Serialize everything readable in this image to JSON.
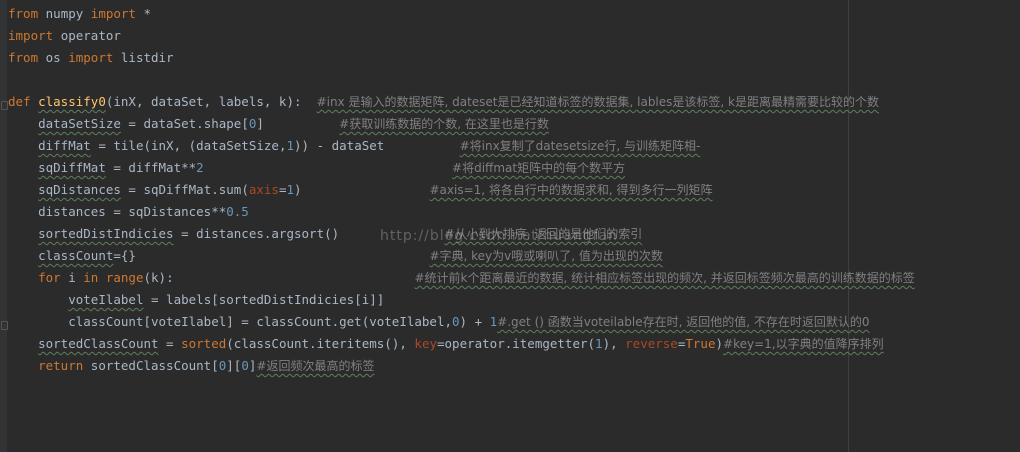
{
  "lines": [
    {
      "segments": [
        {
          "t": "from ",
          "c": "kw"
        },
        {
          "t": "numpy ",
          "c": "op"
        },
        {
          "t": "import ",
          "c": "kw"
        },
        {
          "t": "*",
          "c": "op"
        }
      ]
    },
    {
      "segments": [
        {
          "t": "import ",
          "c": "kw"
        },
        {
          "t": "operator",
          "c": "op"
        }
      ]
    },
    {
      "segments": [
        {
          "t": "from ",
          "c": "kw"
        },
        {
          "t": "os ",
          "c": "op"
        },
        {
          "t": "import ",
          "c": "kw"
        },
        {
          "t": "listdir",
          "c": "op"
        }
      ]
    },
    {
      "segments": []
    },
    {
      "segments": [
        {
          "t": "def ",
          "c": "kw"
        },
        {
          "t": "classify0",
          "c": "fn wavy"
        },
        {
          "t": "(inX, dataSet, labels, k):  ",
          "c": "op"
        },
        {
          "t": "#inx 是输入的数据矩阵, dateset是已经知道标签的数据集, lables是该标签, k是距离最精需要比较的个数",
          "c": "cm wavy"
        }
      ]
    },
    {
      "segments": [
        {
          "t": "    ",
          "c": "op"
        },
        {
          "t": "dataSetSize",
          "c": "op wavy"
        },
        {
          "t": " = dataSet.shape[",
          "c": "op"
        },
        {
          "t": "0",
          "c": "num"
        },
        {
          "t": "]          ",
          "c": "op"
        },
        {
          "t": "#获取训练数据的个数, 在这里也是行数",
          "c": "cm wavy"
        }
      ]
    },
    {
      "segments": [
        {
          "t": "    ",
          "c": "op"
        },
        {
          "t": "diffMat",
          "c": "op wavy"
        },
        {
          "t": " = tile(inX, (dataSetSize,",
          "c": "op"
        },
        {
          "t": "1",
          "c": "num"
        },
        {
          "t": ")) - dataSet          ",
          "c": "op"
        },
        {
          "t": "#将inx复制了datesetsize行, 与训练矩阵相-",
          "c": "cm wavy"
        }
      ]
    },
    {
      "segments": [
        {
          "t": "    ",
          "c": "op"
        },
        {
          "t": "sqDiffMat",
          "c": "op wavy"
        },
        {
          "t": " = diffMat**",
          "c": "op"
        },
        {
          "t": "2",
          "c": "num"
        },
        {
          "t": "                                 ",
          "c": "op"
        },
        {
          "t": "#将diffmat矩阵中的每个数平方",
          "c": "cm wavy"
        }
      ]
    },
    {
      "segments": [
        {
          "t": "    ",
          "c": "op"
        },
        {
          "t": "sqDistances",
          "c": "op wavy"
        },
        {
          "t": " = sqDiffMat.sum(",
          "c": "op"
        },
        {
          "t": "axis",
          "c": "param"
        },
        {
          "t": "=",
          "c": "op"
        },
        {
          "t": "1",
          "c": "num"
        },
        {
          "t": ")                 ",
          "c": "op"
        },
        {
          "t": "#axis=1, 将各自行中的数据求和, 得到多行一列矩阵",
          "c": "cm wavy"
        }
      ]
    },
    {
      "segments": [
        {
          "t": "    distances = sqDistances**",
          "c": "op"
        },
        {
          "t": "0.5",
          "c": "num"
        }
      ]
    },
    {
      "segments": [
        {
          "t": "    ",
          "c": "op"
        },
        {
          "t": "sortedDistIndicies",
          "c": "op wavy"
        },
        {
          "t": " = distances.argsort()              ",
          "c": "op"
        },
        {
          "t": "#从小到大排序, 返回的是他们的索引",
          "c": "cm wavy"
        }
      ]
    },
    {
      "segments": [
        {
          "t": "    ",
          "c": "op"
        },
        {
          "t": "classCount",
          "c": "op wavy"
        },
        {
          "t": "={}                                       ",
          "c": "op"
        },
        {
          "t": "#字典, key为v哦或喇叭了, 值为出现的次数",
          "c": "cm wavy"
        }
      ]
    },
    {
      "segments": [
        {
          "t": "    ",
          "c": "op"
        },
        {
          "t": "for ",
          "c": "kw"
        },
        {
          "t": "i ",
          "c": "op"
        },
        {
          "t": "in ",
          "c": "kw"
        },
        {
          "t": "range",
          "c": "kw"
        },
        {
          "t": "(k):                                ",
          "c": "op"
        },
        {
          "t": "#统计前k个距离最近的数据, 统计相应标签出现的频次, 并返回标签频次最高的训练数据的标签",
          "c": "cm wavy"
        }
      ]
    },
    {
      "segments": [
        {
          "t": "        ",
          "c": "op"
        },
        {
          "t": "voteIlabel",
          "c": "op wavy"
        },
        {
          "t": " = labels[sortedDistIndicies[i]]",
          "c": "op"
        }
      ]
    },
    {
      "segments": [
        {
          "t": "        classCount[voteIlabel] = classCount.get(voteIlabel,",
          "c": "op"
        },
        {
          "t": "0",
          "c": "num"
        },
        {
          "t": ") + ",
          "c": "op"
        },
        {
          "t": "1",
          "c": "num"
        },
        {
          "t": "#.get () 函数当voteilable存在时, 返回他的值, 不存在时返回默认的0",
          "c": "cm wavy"
        }
      ]
    },
    {
      "segments": [
        {
          "t": "    ",
          "c": "op"
        },
        {
          "t": "sortedClassCount",
          "c": "op wavy"
        },
        {
          "t": " = ",
          "c": "op"
        },
        {
          "t": "sorted",
          "c": "kw"
        },
        {
          "t": "(classCount.iteritems(), ",
          "c": "op"
        },
        {
          "t": "key",
          "c": "param"
        },
        {
          "t": "=operator.itemgetter(",
          "c": "op"
        },
        {
          "t": "1",
          "c": "num"
        },
        {
          "t": "), ",
          "c": "op"
        },
        {
          "t": "reverse",
          "c": "param"
        },
        {
          "t": "=",
          "c": "op"
        },
        {
          "t": "True",
          "c": "kw"
        },
        {
          "t": ")",
          "c": "op"
        },
        {
          "t": "#key=1,以字典的值降序排列",
          "c": "cm wavy"
        }
      ]
    },
    {
      "segments": [
        {
          "t": "    ",
          "c": "op"
        },
        {
          "t": "return ",
          "c": "kw"
        },
        {
          "t": "sortedClassCount[",
          "c": "op"
        },
        {
          "t": "0",
          "c": "num"
        },
        {
          "t": "][",
          "c": "op"
        },
        {
          "t": "0",
          "c": "num"
        },
        {
          "t": "]",
          "c": "op"
        },
        {
          "t": "#返回频次最高的标签",
          "c": "cm wavy"
        }
      ]
    }
  ],
  "watermark": "http://blog.csdn.net/huangfan"
}
